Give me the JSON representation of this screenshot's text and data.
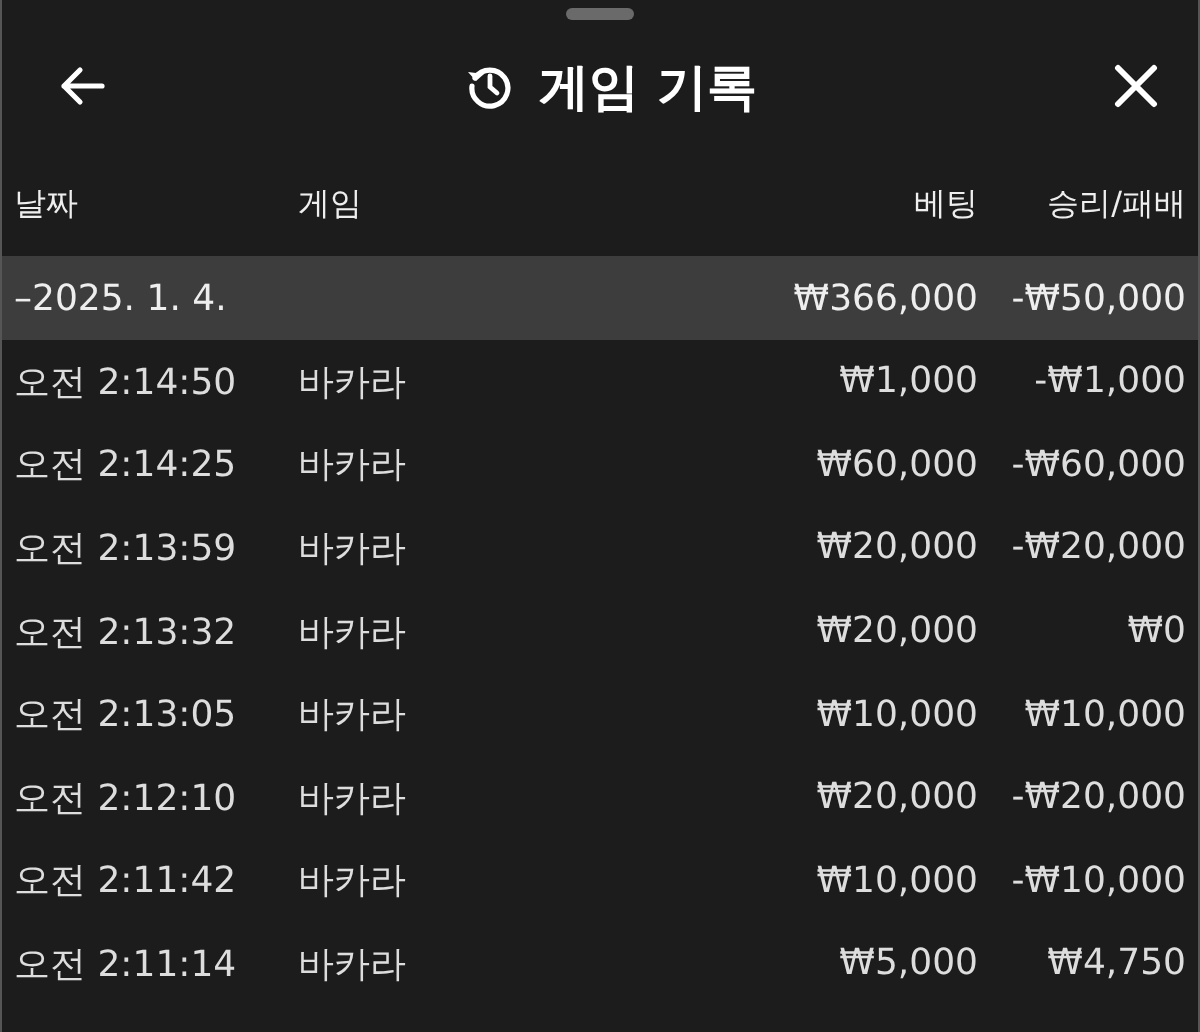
{
  "header": {
    "title": "게임 기록"
  },
  "table": {
    "columns": [
      "날짜",
      "게임",
      "베팅",
      "승리/패배"
    ],
    "summary": {
      "date": "–2025. 1. 4.",
      "bet": "₩366,000",
      "result": "-₩50,000"
    },
    "rows": [
      {
        "time": "오전 2:14:50",
        "game": "바카라",
        "bet": "₩1,000",
        "result": "-₩1,000"
      },
      {
        "time": "오전 2:14:25",
        "game": "바카라",
        "bet": "₩60,000",
        "result": "-₩60,000"
      },
      {
        "time": "오전 2:13:59",
        "game": "바카라",
        "bet": "₩20,000",
        "result": "-₩20,000"
      },
      {
        "time": "오전 2:13:32",
        "game": "바카라",
        "bet": "₩20,000",
        "result": "₩0"
      },
      {
        "time": "오전 2:13:05",
        "game": "바카라",
        "bet": "₩10,000",
        "result": "₩10,000"
      },
      {
        "time": "오전 2:12:10",
        "game": "바카라",
        "bet": "₩20,000",
        "result": "-₩20,000"
      },
      {
        "time": "오전 2:11:42",
        "game": "바카라",
        "bet": "₩10,000",
        "result": "-₩10,000"
      },
      {
        "time": "오전 2:11:14",
        "game": "바카라",
        "bet": "₩5,000",
        "result": "₩4,750"
      }
    ]
  }
}
